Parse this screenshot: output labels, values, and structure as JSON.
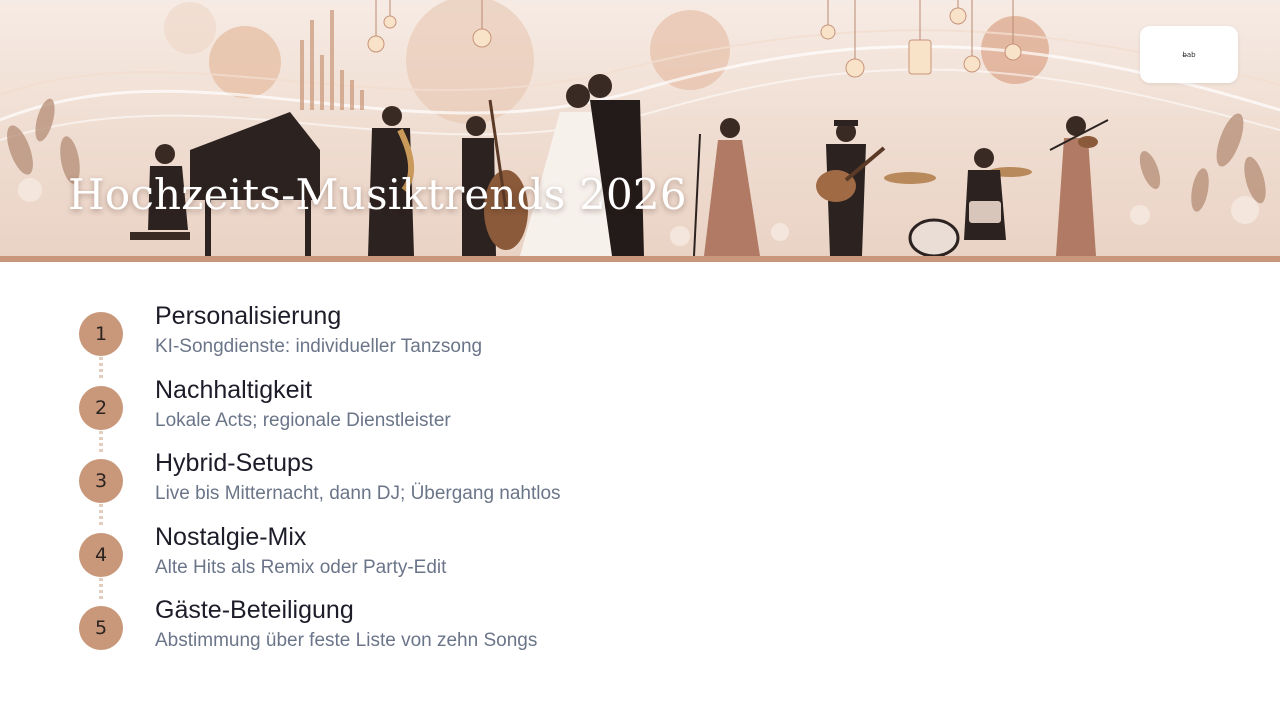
{
  "slide": {
    "title": "Hochzeits-Musiktrends 2026",
    "logo_text": "b̶ab",
    "accent_color": "#c99779"
  },
  "items": [
    {
      "number": "1",
      "title": "Personalisierung",
      "description": "KI-Songdienste: individueller Tanzsong"
    },
    {
      "number": "2",
      "title": "Nachhaltigkeit",
      "description": "Lokale Acts; regionale Dienstleister"
    },
    {
      "number": "3",
      "title": "Hybrid-Setups",
      "description": "Live bis Mitternacht, dann DJ; Übergang nahtlos"
    },
    {
      "number": "4",
      "title": "Nostalgie-Mix",
      "description": "Alte Hits als Remix oder Party-Edit"
    },
    {
      "number": "5",
      "title": "Gäste-Beteiligung",
      "description": "Abstimmung über feste Liste von zehn Songs"
    }
  ]
}
